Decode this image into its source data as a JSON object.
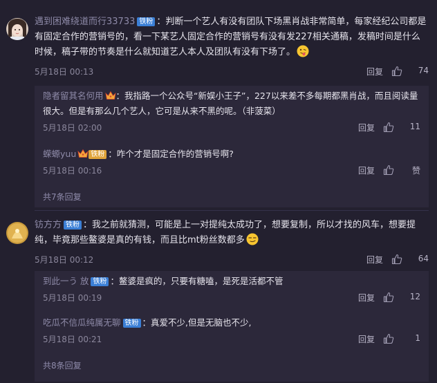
{
  "comments": [
    {
      "username": "遇到困难绕道而行33733",
      "badge": "铁粉",
      "text": "：判断一个艺人有没有团队下场黑肖战非常简单，每家经纪公司都是有固定合作的营销号的，看一下某艺人固定合作的营销号有没有发227相关通稿，发稿时间是什么时候，稿子带的节奏是什么就知道艺人本人及团队有没有下场了。",
      "emoji": "tongue-out-emoji",
      "time": "5月18日 00:13",
      "reply_label": "回复",
      "likes": "74",
      "replies": [
        {
          "username": "隐者留其名何用",
          "text": "：我指路一个公众号“新娱小王子”，227以来差不多每期都黑肖战，而且阅读量很大。但是有那么几个艺人，它可是从来不黑的呢。（非菠菜）",
          "time": "5月18日 02:00",
          "reply_label": "回复",
          "likes": "11"
        },
        {
          "username": "蝾螈yuu",
          "badge": "铁粉",
          "text": "：咋个才是固定合作的营销号啊?",
          "time": "5月18日 00:16",
          "reply_label": "回复",
          "likes": "赞"
        }
      ],
      "more_replies": "共7条回复"
    },
    {
      "username": "钫方方",
      "badge": "铁粉",
      "text": "：我之前就猜测，可能是上一对提纯太成功了，想要复制，所以才找的风车，想要提纯，毕竟那些鳌婆是真的有钱，而且比mt粉丝数都多",
      "emoji": "smirk-emoji",
      "time": "5月18日 00:12",
      "reply_label": "回复",
      "likes": "64",
      "replies": [
        {
          "username": "到此一う 放",
          "badge": "铁粉",
          "text": "：鳌婆是疯的，只要有糖嗑，是死是活都不管",
          "time": "5月18日 00:19",
          "reply_label": "回复",
          "likes": "12"
        },
        {
          "username": "吃瓜不信瓜纯属无聊",
          "badge": "铁粉",
          "text": "：真爱不少,但是无脑也不少,",
          "time": "5月18日 00:21",
          "reply_label": "回复",
          "likes": "1"
        }
      ],
      "more_replies": "共8条回复"
    }
  ],
  "colors": {
    "background": "#23202f",
    "reply_background": "#2c283a",
    "username": "#8e8aa8",
    "badge": "#3b7fd6"
  }
}
